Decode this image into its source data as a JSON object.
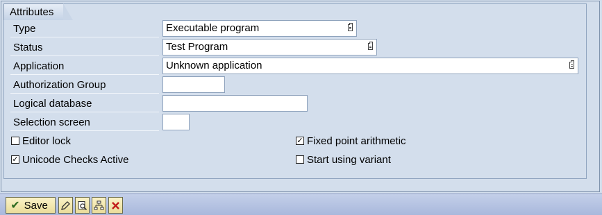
{
  "group": {
    "title": "Attributes"
  },
  "fields": {
    "type": {
      "label": "Type",
      "value": "Executable program"
    },
    "status": {
      "label": "Status",
      "value": "Test Program"
    },
    "application": {
      "label": "Application",
      "value": "Unknown application"
    },
    "auth_group": {
      "label": "Authorization Group",
      "value": ""
    },
    "logical_db": {
      "label": "Logical database",
      "value": ""
    },
    "selection_screen": {
      "label": "Selection screen",
      "value": ""
    }
  },
  "checkboxes": {
    "editor_lock": {
      "label": "Editor lock",
      "checked": false
    },
    "unicode": {
      "label": "Unicode Checks Active",
      "checked": true
    },
    "fixed_point": {
      "label": "Fixed point arithmetic",
      "checked": true
    },
    "start_variant": {
      "label": "Start using variant",
      "checked": false
    }
  },
  "toolbar": {
    "save_label": "Save",
    "icons": [
      "edit-pen-icon",
      "search-doc-icon",
      "hierarchy-icon",
      "cancel-x-icon"
    ]
  }
}
